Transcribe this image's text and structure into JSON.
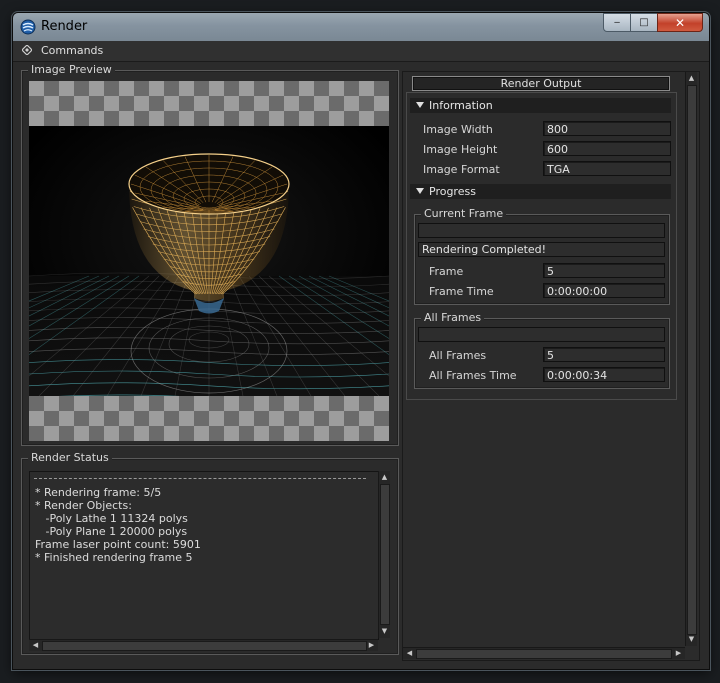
{
  "window": {
    "title": "Render",
    "minimize_glyph": "‒",
    "maximize_glyph": "□",
    "close_glyph": "✕"
  },
  "commands": {
    "label": "Commands"
  },
  "image_preview": {
    "label": "Image Preview"
  },
  "render_status": {
    "label": "Render Status",
    "log": [
      "* Rendering frame: 5/5",
      "* Render Objects:",
      "   -Poly Lathe 1 11324 polys",
      "   -Poly Plane 1 20000 polys",
      "Frame laser point count: 5901",
      "* Finished rendering frame 5"
    ]
  },
  "render_output": {
    "title": "Render Output",
    "information": {
      "header": "Information",
      "rows": [
        {
          "label": "Image Width",
          "value": "800"
        },
        {
          "label": "Image Height",
          "value": "600"
        },
        {
          "label": "Image Format",
          "value": "TGA"
        }
      ]
    },
    "progress": {
      "header": "Progress",
      "current_frame": {
        "label": "Current Frame",
        "progress_fraction": 0,
        "status": "Rendering Completed!",
        "rows": [
          {
            "label": "Frame",
            "value": "5"
          },
          {
            "label": "Frame Time",
            "value": "0:00:00:00"
          }
        ]
      },
      "all_frames": {
        "label": "All Frames",
        "progress_fraction": 0,
        "rows": [
          {
            "label": "All Frames",
            "value": "5"
          },
          {
            "label": "All Frames Time",
            "value": "0:00:00:34"
          }
        ]
      }
    }
  },
  "colors": {
    "window_bg": "#2b2b2b",
    "titlebar": "#8593a0",
    "close_button": "#c2412a",
    "wire_gold": "#e8b45a",
    "wire_cyan": "#5fd0d8"
  },
  "icons": {
    "app": "render-app-icon",
    "commands": "diamond-icon"
  }
}
